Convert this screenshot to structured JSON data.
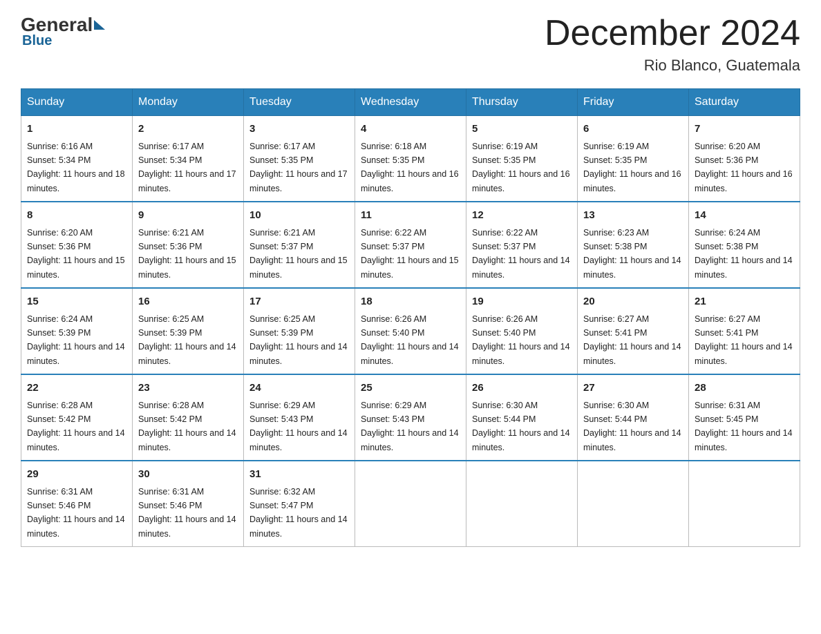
{
  "header": {
    "logo_general": "General",
    "logo_blue": "Blue",
    "month_title": "December 2024",
    "location": "Rio Blanco, Guatemala"
  },
  "days_of_week": [
    "Sunday",
    "Monday",
    "Tuesday",
    "Wednesday",
    "Thursday",
    "Friday",
    "Saturday"
  ],
  "weeks": [
    [
      {
        "day": "1",
        "sunrise": "6:16 AM",
        "sunset": "5:34 PM",
        "daylight": "11 hours and 18 minutes."
      },
      {
        "day": "2",
        "sunrise": "6:17 AM",
        "sunset": "5:34 PM",
        "daylight": "11 hours and 17 minutes."
      },
      {
        "day": "3",
        "sunrise": "6:17 AM",
        "sunset": "5:35 PM",
        "daylight": "11 hours and 17 minutes."
      },
      {
        "day": "4",
        "sunrise": "6:18 AM",
        "sunset": "5:35 PM",
        "daylight": "11 hours and 16 minutes."
      },
      {
        "day": "5",
        "sunrise": "6:19 AM",
        "sunset": "5:35 PM",
        "daylight": "11 hours and 16 minutes."
      },
      {
        "day": "6",
        "sunrise": "6:19 AM",
        "sunset": "5:35 PM",
        "daylight": "11 hours and 16 minutes."
      },
      {
        "day": "7",
        "sunrise": "6:20 AM",
        "sunset": "5:36 PM",
        "daylight": "11 hours and 16 minutes."
      }
    ],
    [
      {
        "day": "8",
        "sunrise": "6:20 AM",
        "sunset": "5:36 PM",
        "daylight": "11 hours and 15 minutes."
      },
      {
        "day": "9",
        "sunrise": "6:21 AM",
        "sunset": "5:36 PM",
        "daylight": "11 hours and 15 minutes."
      },
      {
        "day": "10",
        "sunrise": "6:21 AM",
        "sunset": "5:37 PM",
        "daylight": "11 hours and 15 minutes."
      },
      {
        "day": "11",
        "sunrise": "6:22 AM",
        "sunset": "5:37 PM",
        "daylight": "11 hours and 15 minutes."
      },
      {
        "day": "12",
        "sunrise": "6:22 AM",
        "sunset": "5:37 PM",
        "daylight": "11 hours and 14 minutes."
      },
      {
        "day": "13",
        "sunrise": "6:23 AM",
        "sunset": "5:38 PM",
        "daylight": "11 hours and 14 minutes."
      },
      {
        "day": "14",
        "sunrise": "6:24 AM",
        "sunset": "5:38 PM",
        "daylight": "11 hours and 14 minutes."
      }
    ],
    [
      {
        "day": "15",
        "sunrise": "6:24 AM",
        "sunset": "5:39 PM",
        "daylight": "11 hours and 14 minutes."
      },
      {
        "day": "16",
        "sunrise": "6:25 AM",
        "sunset": "5:39 PM",
        "daylight": "11 hours and 14 minutes."
      },
      {
        "day": "17",
        "sunrise": "6:25 AM",
        "sunset": "5:39 PM",
        "daylight": "11 hours and 14 minutes."
      },
      {
        "day": "18",
        "sunrise": "6:26 AM",
        "sunset": "5:40 PM",
        "daylight": "11 hours and 14 minutes."
      },
      {
        "day": "19",
        "sunrise": "6:26 AM",
        "sunset": "5:40 PM",
        "daylight": "11 hours and 14 minutes."
      },
      {
        "day": "20",
        "sunrise": "6:27 AM",
        "sunset": "5:41 PM",
        "daylight": "11 hours and 14 minutes."
      },
      {
        "day": "21",
        "sunrise": "6:27 AM",
        "sunset": "5:41 PM",
        "daylight": "11 hours and 14 minutes."
      }
    ],
    [
      {
        "day": "22",
        "sunrise": "6:28 AM",
        "sunset": "5:42 PM",
        "daylight": "11 hours and 14 minutes."
      },
      {
        "day": "23",
        "sunrise": "6:28 AM",
        "sunset": "5:42 PM",
        "daylight": "11 hours and 14 minutes."
      },
      {
        "day": "24",
        "sunrise": "6:29 AM",
        "sunset": "5:43 PM",
        "daylight": "11 hours and 14 minutes."
      },
      {
        "day": "25",
        "sunrise": "6:29 AM",
        "sunset": "5:43 PM",
        "daylight": "11 hours and 14 minutes."
      },
      {
        "day": "26",
        "sunrise": "6:30 AM",
        "sunset": "5:44 PM",
        "daylight": "11 hours and 14 minutes."
      },
      {
        "day": "27",
        "sunrise": "6:30 AM",
        "sunset": "5:44 PM",
        "daylight": "11 hours and 14 minutes."
      },
      {
        "day": "28",
        "sunrise": "6:31 AM",
        "sunset": "5:45 PM",
        "daylight": "11 hours and 14 minutes."
      }
    ],
    [
      {
        "day": "29",
        "sunrise": "6:31 AM",
        "sunset": "5:46 PM",
        "daylight": "11 hours and 14 minutes."
      },
      {
        "day": "30",
        "sunrise": "6:31 AM",
        "sunset": "5:46 PM",
        "daylight": "11 hours and 14 minutes."
      },
      {
        "day": "31",
        "sunrise": "6:32 AM",
        "sunset": "5:47 PM",
        "daylight": "11 hours and 14 minutes."
      },
      null,
      null,
      null,
      null
    ]
  ]
}
